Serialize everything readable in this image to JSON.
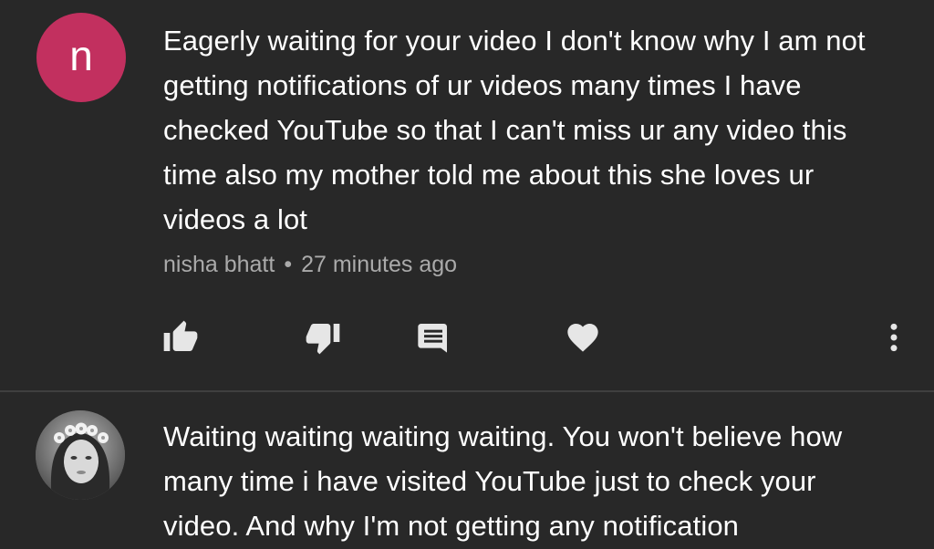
{
  "comments": [
    {
      "avatar_letter": "n",
      "avatar_color": "#c2305f",
      "text": "Eagerly waiting for your video I don't know why I am not getting notifications of ur videos many times I have checked YouTube so that I can't miss ur any video this time also my mother told me about this she loves ur videos a lot",
      "author": "nisha bhatt",
      "separator": "•",
      "time": "27 minutes ago",
      "actions": [
        "thumbs-up-icon",
        "thumbs-down-icon",
        "reply-icon",
        "heart-icon",
        "more-vert-icon"
      ]
    },
    {
      "avatar_type": "photo",
      "text": "Waiting waiting waiting waiting. You won't believe how many time i have visited YouTube just to check your video. And why I'm not getting any notification"
    }
  ],
  "colors": {
    "background": "#282828",
    "text": "#ffffff",
    "secondary_text": "#aaaaaa",
    "icon": "#e6e6e6",
    "divider": "#3f3f3f"
  }
}
